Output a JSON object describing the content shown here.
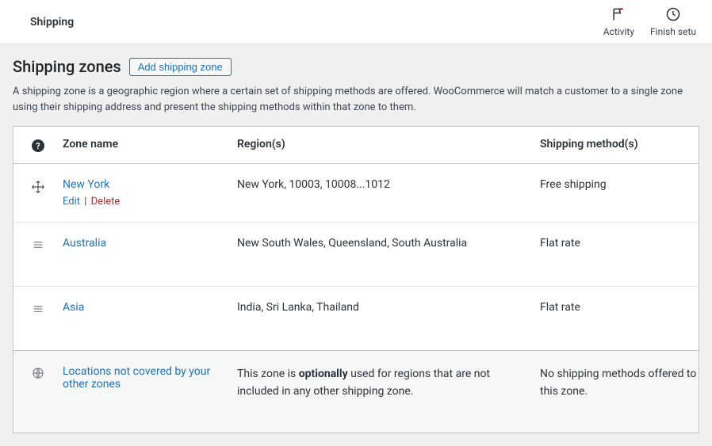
{
  "topbar": {
    "title": "Shipping",
    "activity_label": "Activity",
    "finish_label": "Finish setu"
  },
  "page": {
    "heading": "Shipping zones",
    "add_button": "Add shipping zone",
    "description": "A shipping zone is a geographic region where a certain set of shipping methods are offered. WooCommerce will match a customer to a single zone using their shipping address and present the shipping methods within that zone to them."
  },
  "table": {
    "headers": {
      "name": "Zone name",
      "regions": "Region(s)",
      "methods": "Shipping method(s)"
    },
    "zones": [
      {
        "name": "New York",
        "regions": "New York, 10003, 10008...1012",
        "methods": "Free shipping",
        "active": true
      },
      {
        "name": "Australia",
        "regions": "New South Wales, Queensland, South Australia",
        "methods": "Flat rate",
        "active": false
      },
      {
        "name": "Asia",
        "regions": "India, Sri Lanka, Thailand",
        "methods": "Flat rate",
        "active": false
      }
    ],
    "row_actions": {
      "edit": "Edit",
      "delete": "Delete"
    },
    "default_zone": {
      "name": "Locations not covered by your other zones",
      "regions_pre": "This zone is ",
      "regions_bold": "optionally",
      "regions_post": " used for regions that are not included in any other shipping zone.",
      "methods": "No shipping methods offered to this zone."
    }
  }
}
